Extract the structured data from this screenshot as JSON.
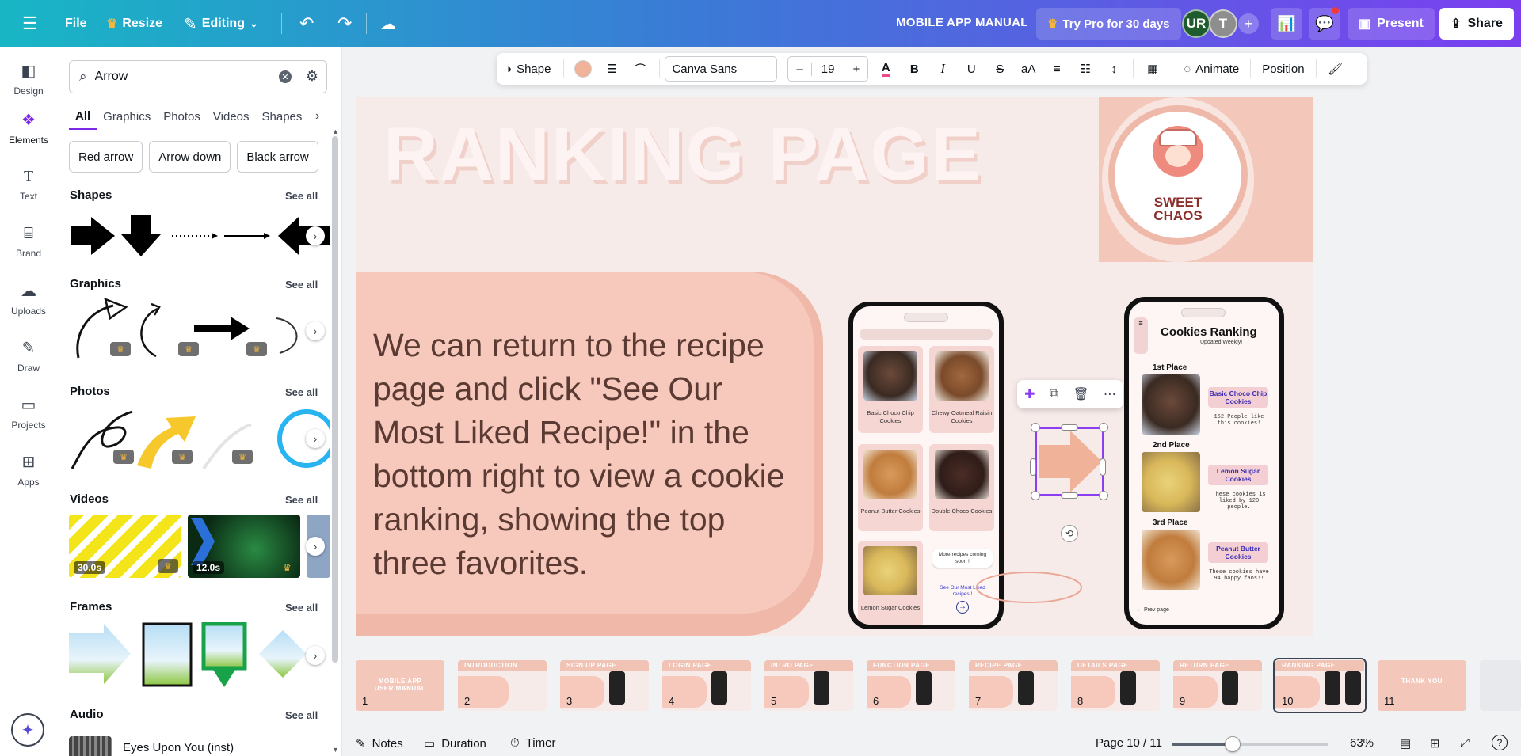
{
  "topbar": {
    "menu_icon": "hamburger-icon",
    "file_label": "File",
    "resize_label": "Resize",
    "editing_label": "Editing",
    "doc_title": "MOBILE APP MANUAL",
    "pro_label": "Try Pro for 30 days",
    "avatars": [
      "UR",
      "T"
    ],
    "present_label": "Present",
    "share_label": "Share",
    "brand_gradient": [
      "#18b6c5",
      "#7b3ff0"
    ]
  },
  "rail": [
    {
      "label": "Design",
      "icon": "design-icon"
    },
    {
      "label": "Elements",
      "icon": "elements-icon"
    },
    {
      "label": "Text",
      "icon": "text-icon"
    },
    {
      "label": "Brand",
      "icon": "brand-icon"
    },
    {
      "label": "Uploads",
      "icon": "uploads-icon"
    },
    {
      "label": "Draw",
      "icon": "draw-icon"
    },
    {
      "label": "Projects",
      "icon": "projects-icon"
    },
    {
      "label": "Apps",
      "icon": "apps-icon"
    }
  ],
  "panel": {
    "search_value": "Arrow",
    "tabs": [
      "All",
      "Graphics",
      "Photos",
      "Videos",
      "Shapes"
    ],
    "chips": [
      "Red arrow",
      "Arrow down",
      "Black arrow"
    ],
    "see_all": "See all",
    "sections": {
      "shapes": "Shapes",
      "graphics": "Graphics",
      "photos": "Photos",
      "videos": "Videos",
      "frames": "Frames",
      "audio": "Audio"
    },
    "videos": [
      {
        "duration": "30.0s"
      },
      {
        "duration": "12.0s"
      }
    ],
    "audio_track": "Eyes Upon You (inst)"
  },
  "toolbar": {
    "shape_label": "Shape",
    "font_name": "Canva Sans",
    "font_size": "19",
    "animate_label": "Animate",
    "position_label": "Position",
    "fill_color": "#f1b29a"
  },
  "slide": {
    "title": "RANKING PAGE",
    "brand_line1": "SWEET",
    "brand_line2": "CHAOS",
    "body": "We can return to the recipe page and click \"See Our Most Liked Recipe!\" in the bottom right to view a cookie ranking, showing the top three favorites.",
    "phone1": {
      "cards": [
        {
          "label": "Basic Choco Chip Cookies"
        },
        {
          "label": "Chewy Oatmeal Raisin Cookies"
        },
        {
          "label": "Peanut Butter Cookies"
        },
        {
          "label": "Double Choco Cookies"
        },
        {
          "label": "Lemon Sugar Cookies"
        }
      ],
      "more_label": "More recipes coming soon !",
      "liked_label": "See Our Most Liked recipes !"
    },
    "phone2": {
      "title": "Cookies Ranking",
      "subtitle": "Updated Weekly!",
      "places": [
        {
          "place": "1st Place",
          "name": "Basic Choco Chip Cookies",
          "desc": "152 People like this cookies!"
        },
        {
          "place": "2nd Place",
          "name": "Lemon Sugar Cookies",
          "desc": "These cookies is liked by 120 people."
        },
        {
          "place": "3rd Place",
          "name": "Peanut Butter Cookies",
          "desc": "These cookies have 94 happy fans!!"
        }
      ],
      "prev_label": "Prev page"
    }
  },
  "filmstrip": {
    "pages": [
      {
        "num": "1",
        "heading": "MOBILE APP USER MANUAL"
      },
      {
        "num": "2",
        "heading": "INTRODUCTION"
      },
      {
        "num": "3",
        "heading": "SIGN UP PAGE"
      },
      {
        "num": "4",
        "heading": "LOGIN PAGE"
      },
      {
        "num": "5",
        "heading": "INTRO PAGE"
      },
      {
        "num": "6",
        "heading": "FUNCTION PAGE"
      },
      {
        "num": "7",
        "heading": "RECIPE PAGE"
      },
      {
        "num": "8",
        "heading": "DETAILS PAGE"
      },
      {
        "num": "9",
        "heading": "RETURN PAGE"
      },
      {
        "num": "10",
        "heading": "RANKING PAGE"
      },
      {
        "num": "11",
        "heading": "THANK YOU"
      }
    ],
    "active_page": 10
  },
  "bottombar": {
    "notes_label": "Notes",
    "duration_label": "Duration",
    "timer_label": "Timer",
    "page_indicator": "Page 10 / 11",
    "zoom_level": "63%",
    "zoom_slider_fraction": 0.39,
    "help_label": "?"
  }
}
